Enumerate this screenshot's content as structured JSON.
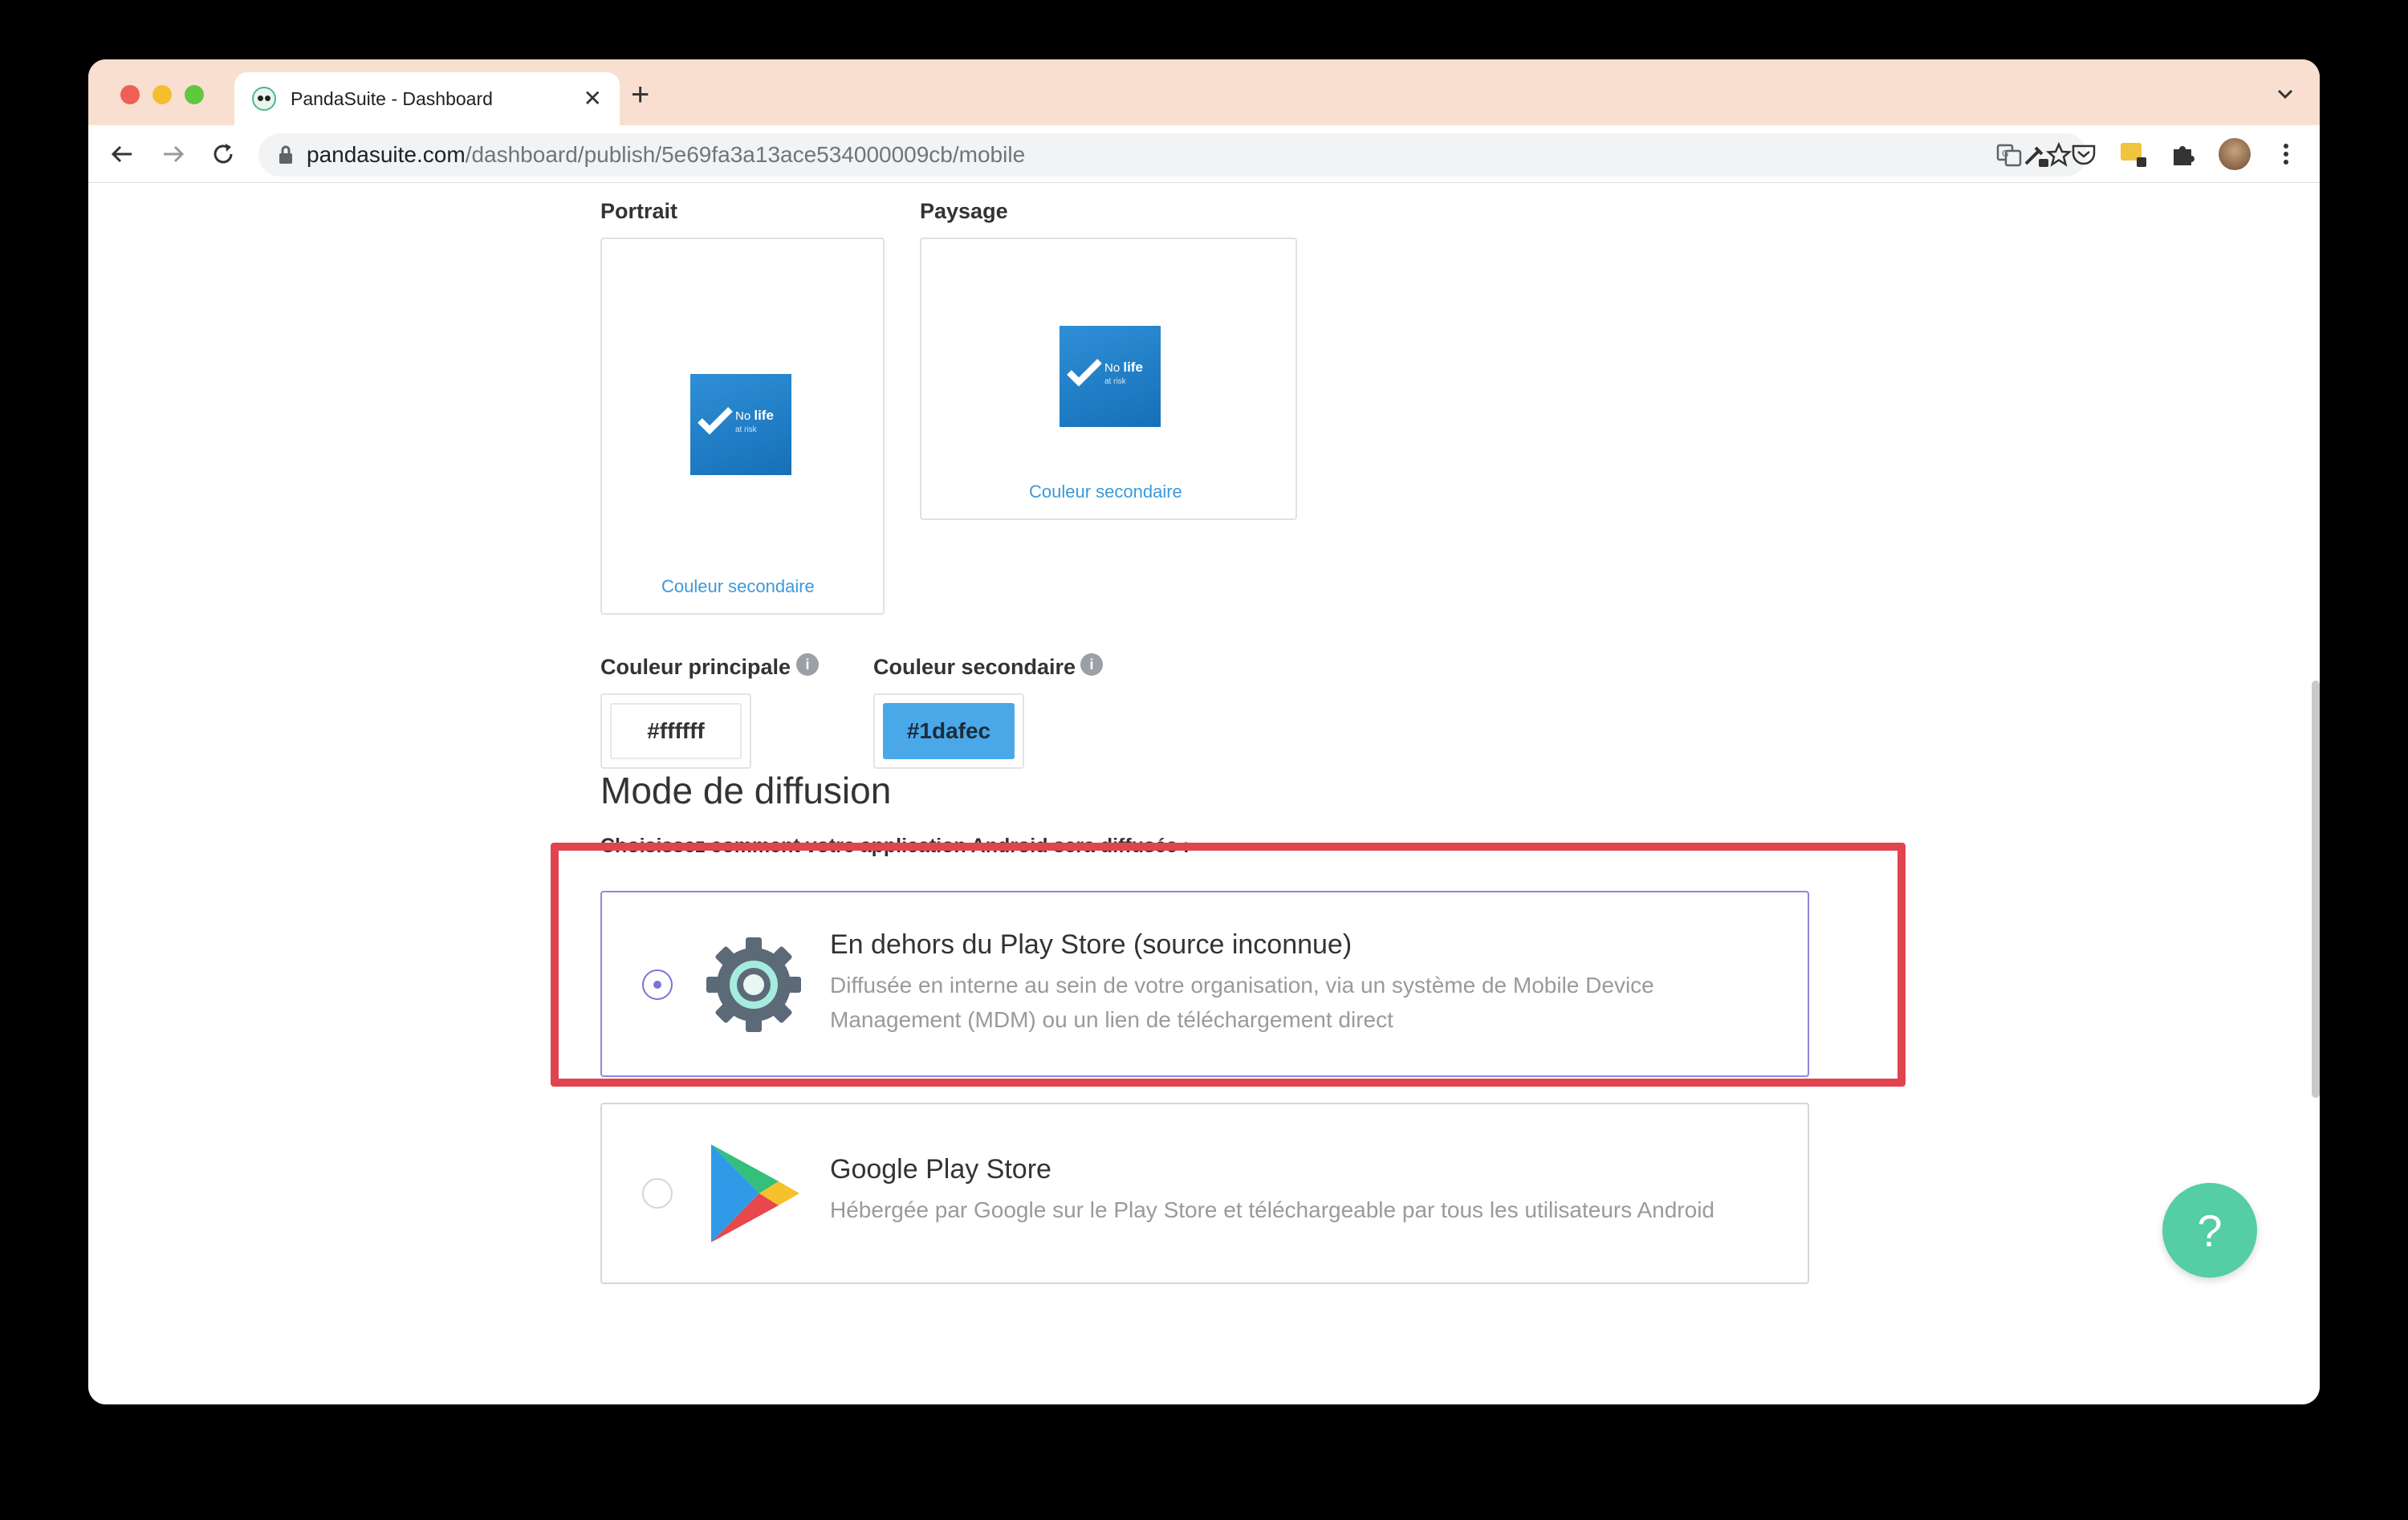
{
  "browser": {
    "tab_title": "PandaSuite - Dashboard",
    "tab_close": "✕",
    "new_tab": "+",
    "url_host": "pandasuite.com",
    "url_path": "/dashboard/publish/5e69fa3a13ace534000009cb/mobile"
  },
  "preview": {
    "portrait_label": "Portrait",
    "landscape_label": "Paysage",
    "portrait_secondary_link": "Couleur secondaire",
    "landscape_secondary_link": "Couleur secondaire",
    "logo_line1": "No",
    "logo_line1_bold": "life",
    "logo_line2": "at risk"
  },
  "colors": {
    "primary_label": "Couleur principale",
    "primary_value": "#ffffff",
    "secondary_label": "Couleur secondaire",
    "secondary_value": "#1dafec",
    "info_glyph": "i"
  },
  "distribution": {
    "title": "Mode de diffusion",
    "subtitle": "Choisissez comment votre application Android sera diffusée :",
    "options": [
      {
        "title": "En dehors du Play Store (source inconnue)",
        "description": "Diffusée en interne au sein de votre organisation, via un système de Mobile Device Management (MDM) ou un lien de téléchargement direct",
        "selected": true,
        "icon": "gear-icon"
      },
      {
        "title": "Google Play Store",
        "description": "Hébergée par Google sur le Play Store et téléchargeable par tous les utilisateurs Android",
        "selected": false,
        "icon": "google-play-icon"
      }
    ]
  },
  "help": {
    "label": "?"
  },
  "theme": {
    "accent": "#7b73d6",
    "highlight": "#e0444e",
    "help_button": "#55cda5",
    "secondary_color_swatch": "#4aa8e8"
  }
}
